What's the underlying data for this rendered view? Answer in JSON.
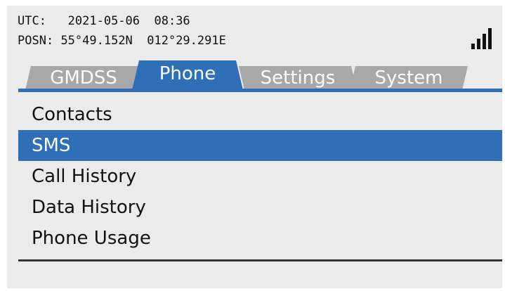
{
  "status": {
    "utc_label": "UTC:",
    "utc_value": "2021-05-06  08:36",
    "posn_label": "POSN:",
    "posn_value": "55°49.152N  012°29.291E",
    "signal_level": 4
  },
  "tabs": [
    {
      "label": "GMDSS",
      "active": false
    },
    {
      "label": "Phone",
      "active": true
    },
    {
      "label": "Settings",
      "active": false
    },
    {
      "label": "System",
      "active": false
    }
  ],
  "menu": {
    "items": [
      {
        "label": "Contacts",
        "selected": false
      },
      {
        "label": "SMS",
        "selected": true
      },
      {
        "label": "Call History",
        "selected": false
      },
      {
        "label": "Data History",
        "selected": false
      },
      {
        "label": "Phone Usage",
        "selected": false
      }
    ]
  },
  "colors": {
    "accent": "#2e6fb7",
    "inactive_tab": "#a8a8a8",
    "screen_bg": "#ebebeb"
  },
  "icons": {
    "signal": "signal-strength-icon"
  }
}
